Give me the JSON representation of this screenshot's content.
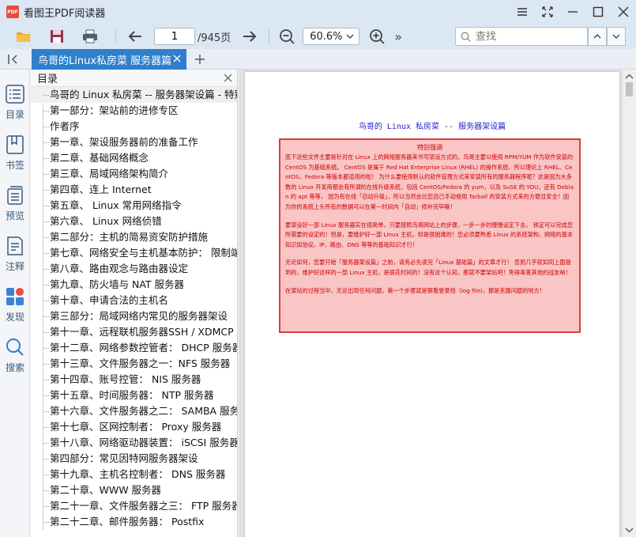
{
  "app": {
    "logo_text": "PDF",
    "title": "看图王PDF阅读器"
  },
  "toolbar": {
    "current_page": "1",
    "total_pages": "/945页",
    "zoom": "60.6%",
    "more": "»",
    "search_placeholder": "查找"
  },
  "tab": {
    "label": "鸟哥的Linux私房菜 服务器篇(第"
  },
  "rail": {
    "items": [
      {
        "label": "目录",
        "icon": "list-icon"
      },
      {
        "label": "书签",
        "icon": "bookmark-icon"
      },
      {
        "label": "预览",
        "icon": "preview-icon"
      },
      {
        "label": "注释",
        "icon": "annotation-icon"
      },
      {
        "label": "发现",
        "icon": "discover-icon"
      },
      {
        "label": "搜索",
        "icon": "search-icon"
      }
    ]
  },
  "outline": {
    "title": "目录",
    "items": [
      "鸟哥的 Linux 私房菜 -- 服务器架设篇 - 特别说",
      "第一部分：架站前的进修专区",
      "作者序",
      "第一章、架设服务器前的准备工作",
      "第二章、基础网络概念",
      "第三章、局域网络架构简介",
      "第四章、连上 Internet",
      "第五章、 Linux 常用网络指令",
      "第六章、 Linux 网络侦错",
      "第二部分：主机的简易资安防护措施",
      "第七章、网络安全与主机基本防护： 限制端口",
      "第八章、路由观念与路由器设定",
      "第九章、防火墙与 NAT 服务器",
      "第十章、申请合法的主机名",
      "第三部分：局域网络内常见的服务器架设",
      "第十一章、远程联机服务器SSH / XDMCP / VN",
      "第十二章、网络参数控管者： DHCP 服务器",
      "第十三章、文件服务器之一：NFS 服务器",
      "第十四章、账号控管： NIS 服务器",
      "第十五章、时间服务器： NTP 服务器",
      "第十六章、文件服务器之二： SAMBA 服务器",
      "第十七章、区网控制者： Proxy 服务器",
      "第十八章、网络驱动器装置： iSCSI 服务器",
      "第四部分：常见因特网服务器架设",
      "第十九章、主机名控制者： DNS 服务器",
      "第二十章、WWW 服务器",
      "第二十一章、文件服务器之三： FTP 服务器",
      "第二十二章、邮件服务器： Postfix"
    ]
  },
  "document": {
    "page_title": "鸟哥的 Linux 私房菜 -- 服务器架设篇",
    "notice_heading": "特别强调",
    "paragraphs": [
      "底下这些文件主要是针对在 Linux 上的网络服务器来书写架设方式的，鸟哥主要以使用 RPM/YUM 作为软件安装的 CentOS 为基础系统。 CentOS 是属于 Red Hat Enterprise Linux (RHEL) 的操作系统，所以理论上 RHEL、CentOS、Fedora 等版本都适用的啦！ 为什么要使用默认的软件管理方式来安装所有的服务器程序呢？这是因为大多数的 Linux 开发商都会有所谓的在线升级系统，包括 CentOS/Fedora 的 yum，以及 SuSE 的 YOU，还有 Debian 的 apt 等等， 因为有在线「自动升级」，所以当然会比您自己手动使用 Tarball 的安装方式来的方便且安全！因为你的系统上头所有的数据可以在第一时间内「自动」修补完毕嘛！",
      "要架设好一部 Linux 服务器实在很简单，只要按照鸟哥网站上的步骤，一步一步的慢慢设定下去， 铁定可以完成您所需要的设定的！但是，要维护好一部 Linux 主机，却是很困难的！您必须要熟悉 Linux 的系统架构、网络的基本知识如协议、IP、路由、DNS 等等的基础知识才行！",
      "无论如何，您要开始「服务器架设篇」之前，请务必先读完「Linux 基础篇」的文章才行！ 否则几乎就如同上面提到的，维护好这样的一部 Linux 主机，是很花时间的！没有这个认知，那就不要架站吧！免得毒害其他的战友呐！",
      "在架站的过程当中，无论出现任何问题，第一个步骤就是察看登录档（log file)，那是克服问题的地方！"
    ]
  },
  "colors": {
    "accent": "#2f7fcc",
    "notice_border": "#e23a3a",
    "notice_fill": "#f9c5c5",
    "notice_text": "#cc0000",
    "title_text": "#2222cc"
  }
}
